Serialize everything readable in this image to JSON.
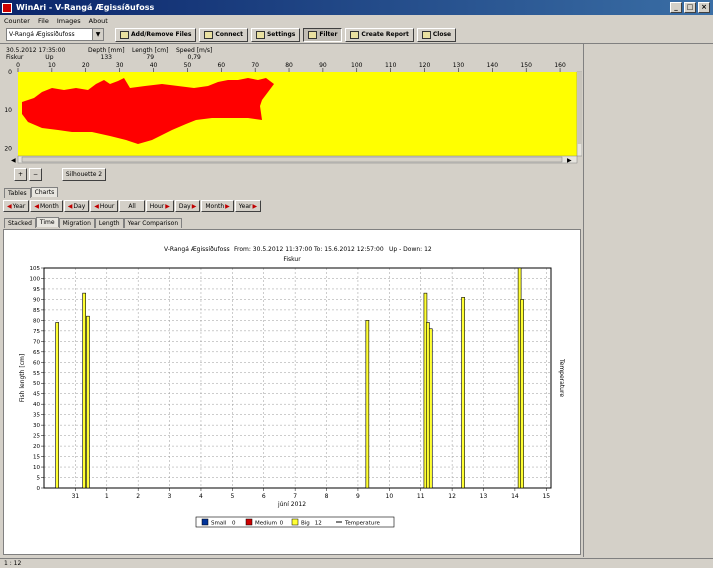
{
  "window": {
    "title": "WinAri - V-Rangá Ægissíðufoss"
  },
  "menu": [
    "Counter",
    "File",
    "Images",
    "About"
  ],
  "toolbar": {
    "location_value": "V-Rangá Ægissíðufoss",
    "buttons": [
      {
        "label": "Add/Remove Files",
        "pressed": false
      },
      {
        "label": "Connect",
        "pressed": false
      },
      {
        "label": "Settings",
        "pressed": false
      },
      {
        "label": "Filter",
        "pressed": true
      },
      {
        "label": "Create Report",
        "pressed": false
      },
      {
        "label": "Close",
        "pressed": false
      }
    ]
  },
  "record": {
    "datetime": "30.5.2012 17:35:00",
    "species": "Fiskur",
    "direction": "Up",
    "depth_label": "Depth [mm]",
    "depth_value": "133",
    "length_label": "Length [cm]",
    "length_value": "79",
    "speed_label": "Speed [m/s]",
    "speed_value": "0,79"
  },
  "silhouette": {
    "x_ticks": [
      "0",
      "10",
      "20",
      "30",
      "40",
      "50",
      "60",
      "70",
      "80",
      "90",
      "100",
      "110",
      "120",
      "130",
      "140",
      "150",
      "160"
    ],
    "y_ticks": [
      "0",
      "10",
      "20"
    ],
    "zoom_in_label": "+",
    "zoom_out_label": "−",
    "button_label": "Silhouette 2",
    "bg_color": "#ffff00",
    "fish_color": "#ff0000"
  },
  "main_tabs": [
    {
      "label": "Tables",
      "active": false
    },
    {
      "label": "Charts",
      "active": true
    }
  ],
  "nav_buttons": [
    "Year",
    "Month",
    "Day",
    "Hour",
    "All",
    "Hour",
    "Day",
    "Month",
    "Year"
  ],
  "chart_tabs": [
    {
      "label": "Stacked",
      "active": false
    },
    {
      "label": "Time",
      "active": true
    },
    {
      "label": "Migration",
      "active": false
    },
    {
      "label": "Length",
      "active": false
    },
    {
      "label": "Year Comparison",
      "active": false
    }
  ],
  "chart_header": {
    "location": "V-Rangá Ægissíðufoss",
    "from": "From: 30.5.2012 11:37:00",
    "to": "To: 15.6.2012 12:57:00",
    "updown": "Up - Down: 12"
  },
  "chart_data": {
    "type": "bar",
    "title": "Fiskur",
    "xlabel": "júní 2012",
    "ylabel": "Fish length [cm]",
    "y2label": "Temperature",
    "ylim": [
      0,
      105
    ],
    "yticks": [
      0,
      5,
      10,
      15,
      20,
      25,
      30,
      35,
      40,
      45,
      50,
      55,
      60,
      65,
      70,
      75,
      80,
      85,
      90,
      95,
      100,
      105
    ],
    "xlim": [
      30.15,
      15.3
    ],
    "x_tick_labels": [
      "31",
      "1",
      "2",
      "3",
      "4",
      "5",
      "6",
      "7",
      "8",
      "9",
      "10",
      "11",
      "12",
      "13",
      "14",
      "15"
    ],
    "x_tick_days": [
      31,
      1,
      2,
      3,
      4,
      5,
      6,
      7,
      8,
      9,
      10,
      11,
      12,
      13,
      14,
      15
    ],
    "grid": true,
    "colors": {
      "Small": "#003399",
      "Medium": "#cc0000",
      "Big": "#ffff33"
    },
    "series": [
      {
        "name": "Small",
        "count": "0",
        "points": []
      },
      {
        "name": "Medium",
        "count": "0",
        "points": []
      },
      {
        "name": "Big",
        "count": "12",
        "points": [
          {
            "date": "2012-05-30",
            "day_offset": 0.27,
            "value": 79
          },
          {
            "date": "2012-05-31",
            "day_offset": 1.13,
            "value": 93
          },
          {
            "date": "2012-05-31",
            "day_offset": 1.25,
            "value": 82
          },
          {
            "date": "2012-06-09",
            "day_offset": 10.15,
            "value": 80
          },
          {
            "date": "2012-06-11",
            "day_offset": 12.0,
            "value": 93
          },
          {
            "date": "2012-06-11",
            "day_offset": 12.08,
            "value": 79
          },
          {
            "date": "2012-06-11",
            "day_offset": 12.17,
            "value": 76
          },
          {
            "date": "2012-06-12",
            "day_offset": 13.2,
            "value": 91
          },
          {
            "date": "2012-06-14",
            "day_offset": 15.0,
            "value": 105
          },
          {
            "date": "2012-06-14",
            "day_offset": 15.08,
            "value": 90
          }
        ]
      },
      {
        "name": "Temperature",
        "points": []
      }
    ],
    "legend": [
      {
        "name": "Small",
        "count": "0"
      },
      {
        "name": "Medium",
        "count": "0"
      },
      {
        "name": "Big",
        "count": "12"
      },
      {
        "name": "Temperature",
        "count": ""
      }
    ],
    "legend_position": "bottom"
  },
  "status": {
    "text": "1 : 12"
  }
}
